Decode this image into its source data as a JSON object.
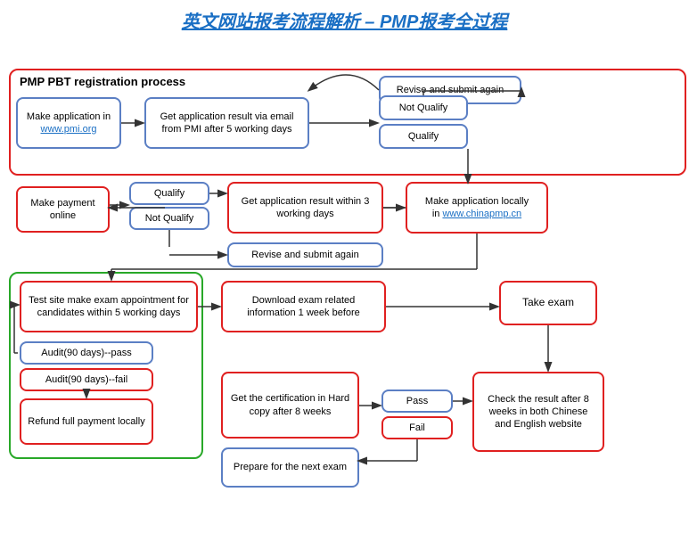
{
  "title": "英文网站报考流程解析 – PMP报考全过程",
  "boxes": {
    "frame_label": "PMP PBT registration process",
    "make_application": "Make application in\nwww.pmi.org",
    "get_result_email": "Get application result via email\nfrom PMI after 5 working days",
    "revise_submit": "Revise and submit again",
    "not_qualify_1": "Not Qualify",
    "qualify_1": "Qualify",
    "make_payment": "Make payment\nonline",
    "qualify_2": "Qualify",
    "not_qualify_2": "Not Qualify",
    "get_result_3days": "Get application result\nwithin 3 working days",
    "make_application_local": "Make application locally\nin www.chinapmp.cn",
    "revise_submit_2": "Revise and submit again",
    "test_site": "Test site make exam appointment for\ncandidates within 5 working days",
    "audit_pass": "Audit(90 days)--pass",
    "audit_fail": "Audit(90 days)--fail",
    "refund": "Refund full payment\nlocally",
    "download_info": "Download exam related\ninformation 1 week before",
    "take_exam": "Take exam",
    "get_certification": "Get the certification\nin Hard copy after 8\nweeks",
    "prepare_next": "Prepare for the\nnext exam",
    "pass": "Pass",
    "fail": "Fail",
    "check_result": "Check the result\nafter 8 weeks in\nboth Chinese and\nEnglish website"
  }
}
